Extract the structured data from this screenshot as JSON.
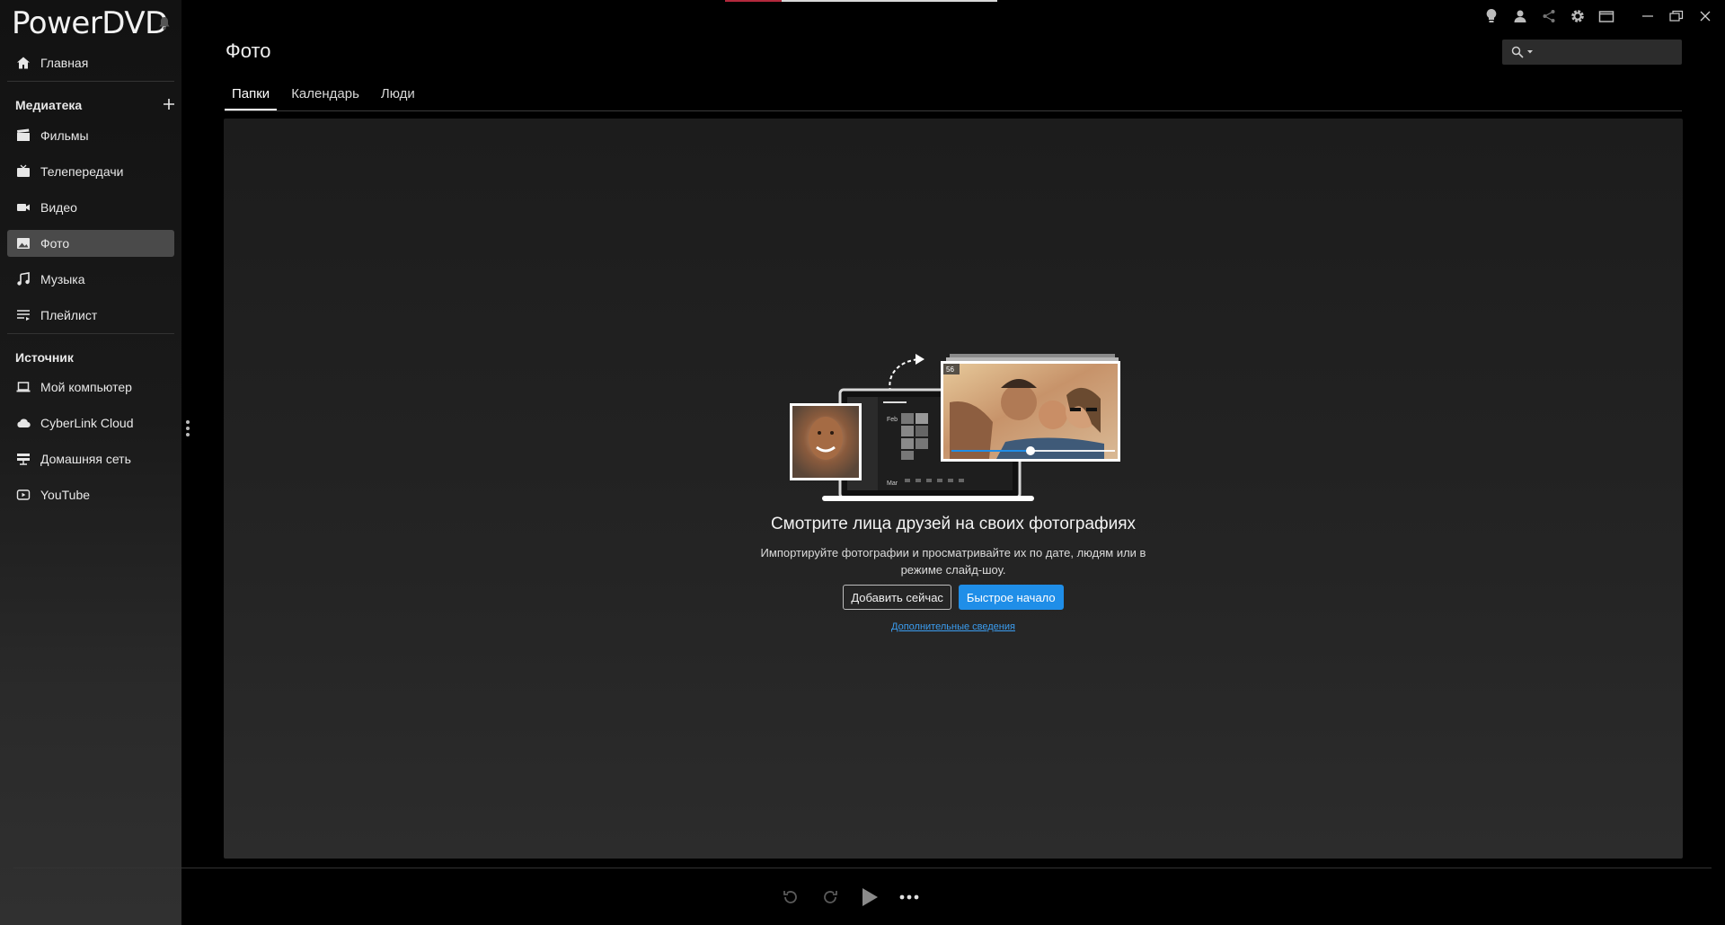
{
  "app": {
    "title": "PowerDVD"
  },
  "sidebar": {
    "home": {
      "label": "Главная",
      "icon": "home-icon"
    },
    "library_title": "Медиатека",
    "library_items": [
      {
        "label": "Фильмы",
        "icon": "movies-icon"
      },
      {
        "label": "Телепередачи",
        "icon": "tv-icon"
      },
      {
        "label": "Видео",
        "icon": "video-camera-icon"
      },
      {
        "label": "Фото",
        "icon": "photo-icon",
        "active": true
      },
      {
        "label": "Музыка",
        "icon": "music-note-icon"
      },
      {
        "label": "Плейлист",
        "icon": "playlist-icon"
      }
    ],
    "source_title": "Источник",
    "source_items": [
      {
        "label": "Мой компьютер",
        "icon": "laptop-icon"
      },
      {
        "label": "CyberLink Cloud",
        "icon": "cloud-icon"
      },
      {
        "label": "Домашняя сеть",
        "icon": "network-icon"
      },
      {
        "label": "YouTube",
        "icon": "youtube-icon"
      }
    ]
  },
  "header": {
    "page_title": "Фото",
    "search_placeholder": "",
    "toolbar_icons": [
      "lightbulb-icon",
      "user-icon",
      "share-icon",
      "settings-icon",
      "mini-player-icon"
    ],
    "window_controls": [
      "minimize-icon",
      "restore-icon",
      "close-icon"
    ]
  },
  "tabs": [
    {
      "label": "Папки",
      "active": true
    },
    {
      "label": "Календарь",
      "active": false
    },
    {
      "label": "Люди",
      "active": false
    }
  ],
  "empty_state": {
    "headline": "Смотрите лица друзей на своих фотографиях",
    "subtext": "Импортируйте фотографии и просматривайте их по дате, людям или в режиме слайд-шоу.",
    "add_button": "Добавить сейчас",
    "quick_start_button": "Быстрое начало",
    "more_link": "Дополнительные сведения",
    "illustration_texts": {
      "badge": "56",
      "month1": "Feb",
      "month2": "Mar"
    }
  },
  "player": {
    "controls": [
      "rewind-icon",
      "forward-icon",
      "play-icon",
      "more-icon"
    ]
  },
  "colors": {
    "accent_blue": "#1f8ee8",
    "link_blue": "#3b9df0",
    "active_nav": "#4a4a4a",
    "top_accent_red": "#b3283c"
  }
}
